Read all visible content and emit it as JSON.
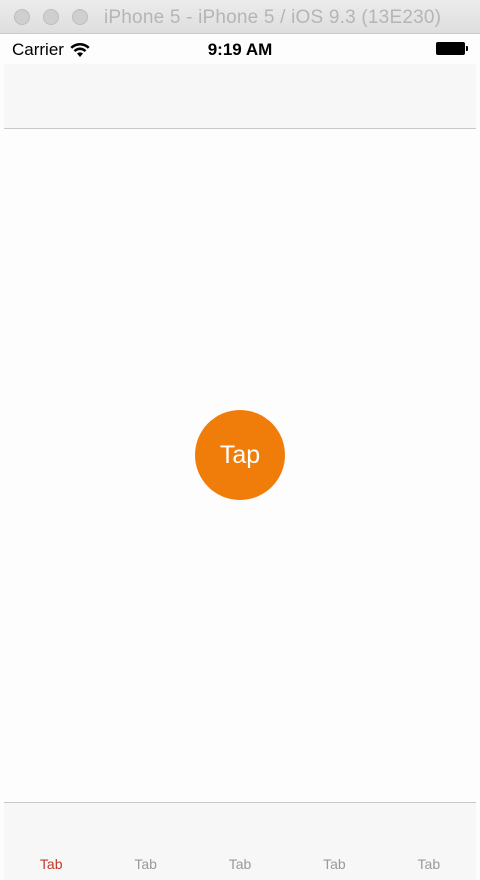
{
  "window": {
    "title": "iPhone 5 - iPhone 5 / iOS 9.3 (13E230)"
  },
  "statusbar": {
    "carrier": "Carrier",
    "time": "9:19 AM",
    "icons": [
      "wifi-icon",
      "battery-icon"
    ]
  },
  "main": {
    "tap_label": "Tap",
    "tap_color": "#f07d0a"
  },
  "tabbar": {
    "active_color": "#c0392b",
    "inactive_color": "#9a9a9a",
    "items": [
      {
        "label": "Tab",
        "active": true
      },
      {
        "label": "Tab",
        "active": false
      },
      {
        "label": "Tab",
        "active": false
      },
      {
        "label": "Tab",
        "active": false
      },
      {
        "label": "Tab",
        "active": false
      }
    ]
  }
}
